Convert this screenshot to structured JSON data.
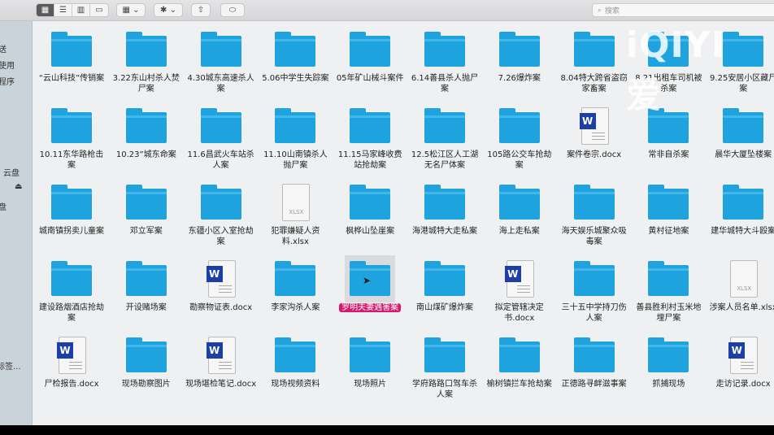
{
  "toolbar": {
    "view_icons": [
      "icon-view",
      "list-view",
      "column-view",
      "gallery-view"
    ],
    "group_icon": "group-icon",
    "action_icon": "gear-icon",
    "share_icon": "share-icon",
    "tag_icon": "tag-icon",
    "search_placeholder": "搜索"
  },
  "sidebar": {
    "items": [
      "送",
      "使用",
      "程序",
      "云盘",
      "⏏",
      "盘",
      "标签..."
    ]
  },
  "watermark": "iQIYI 爱",
  "items": [
    {
      "name": "“云山科技”传销案",
      "type": "folder"
    },
    {
      "name": "3.22东山村杀人焚尸案",
      "type": "folder"
    },
    {
      "name": "4.30城东高速杀人案",
      "type": "folder"
    },
    {
      "name": "5.06中学生失踪案",
      "type": "folder"
    },
    {
      "name": "05年矿山械斗案件",
      "type": "folder"
    },
    {
      "name": "6.14善县杀人抛尸案",
      "type": "folder"
    },
    {
      "name": "7.26爆炸案",
      "type": "folder"
    },
    {
      "name": "8.04特大跨省盗窃家畜案",
      "type": "folder"
    },
    {
      "name": "8.21出租车司机被杀案",
      "type": "folder"
    },
    {
      "name": "9.25安居小区藏尸案",
      "type": "folder"
    },
    {
      "name": "10.11东华路枪击案",
      "type": "folder"
    },
    {
      "name": "10.23”城东命案",
      "type": "folder"
    },
    {
      "name": "11.6昌武火车站杀人案",
      "type": "folder"
    },
    {
      "name": "11.10山南镇杀人抛尸案",
      "type": "folder"
    },
    {
      "name": "11.15马家峰收费站抢劫案",
      "type": "folder"
    },
    {
      "name": "12.5松江区人工湖无名尸体案",
      "type": "folder"
    },
    {
      "name": "105路公交车抢劫案",
      "type": "folder"
    },
    {
      "name": "案件卷宗.docx",
      "type": "docx"
    },
    {
      "name": "常非自杀案",
      "type": "folder"
    },
    {
      "name": "晨华大厦坠楼案",
      "type": "folder"
    },
    {
      "name": "城南镇拐卖儿童案",
      "type": "folder"
    },
    {
      "name": "邓立军案",
      "type": "folder"
    },
    {
      "name": "东疆小区入室抢劫案",
      "type": "folder"
    },
    {
      "name": "犯罪嫌疑人资料.xlsx",
      "type": "xlsx"
    },
    {
      "name": "枫桦山坠崖案",
      "type": "folder"
    },
    {
      "name": "海港城特大走私案",
      "type": "folder"
    },
    {
      "name": "海上走私案",
      "type": "folder"
    },
    {
      "name": "海天娱乐城聚众吸毒案",
      "type": "folder"
    },
    {
      "name": "黄村征地案",
      "type": "folder"
    },
    {
      "name": "建华城特大斗殴案",
      "type": "folder"
    },
    {
      "name": "建设路烟酒店抢劫案",
      "type": "folder"
    },
    {
      "name": "开设赌场案",
      "type": "folder"
    },
    {
      "name": "勘察物证表.docx",
      "type": "docx"
    },
    {
      "name": "李家沟杀人案",
      "type": "folder"
    },
    {
      "name": "罗明夫妻遇害案",
      "type": "folder",
      "selected": true
    },
    {
      "name": "南山煤矿爆炸案",
      "type": "folder"
    },
    {
      "name": "拟定管辖决定书.docx",
      "type": "docx"
    },
    {
      "name": "三十五中学持刀伤人案",
      "type": "folder"
    },
    {
      "name": "善县胜利村玉米地埋尸案",
      "type": "folder"
    },
    {
      "name": "涉案人员名单.xlsx",
      "type": "xlsx"
    },
    {
      "name": "尸检报告.docx",
      "type": "docx"
    },
    {
      "name": "现场勘察图片",
      "type": "folder"
    },
    {
      "name": "现场堪检笔记.docx",
      "type": "docx"
    },
    {
      "name": "现场视频资料",
      "type": "folder"
    },
    {
      "name": "现场照片",
      "type": "folder"
    },
    {
      "name": "学府路路口驾车杀人案",
      "type": "folder"
    },
    {
      "name": "榆树镇拦车抢劫案",
      "type": "folder"
    },
    {
      "name": "正德路寻衅滋事案",
      "type": "folder"
    },
    {
      "name": "抓捕现场",
      "type": "folder"
    },
    {
      "name": "走访记录.docx",
      "type": "docx"
    }
  ],
  "labels": {
    "docx_badge": "W",
    "xlsx_badge": "XLSX"
  },
  "colors": {
    "folder": "#1ea3de",
    "selection_label": "#d4196f",
    "word": "#1b3ea8"
  }
}
